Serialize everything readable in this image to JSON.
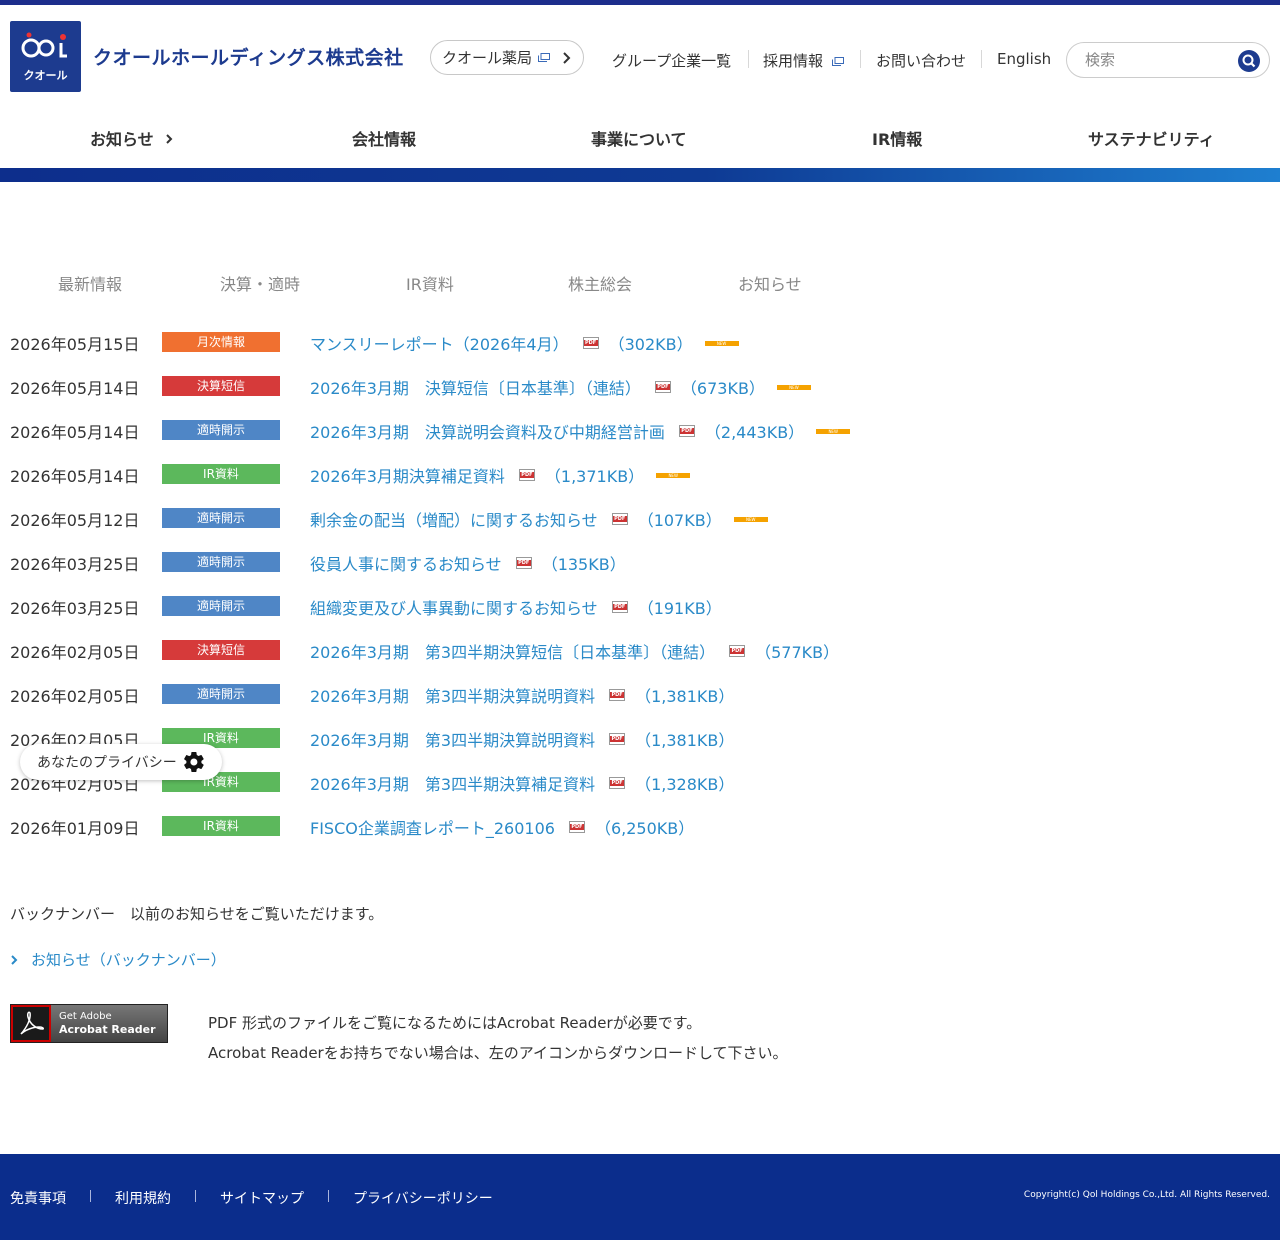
{
  "header": {
    "logo_text": "クオール",
    "company_name": "クオールホールディングス株式会社",
    "pharmacy_button": "クオール薬局",
    "links": [
      "グループ企業一覧",
      "採用情報",
      "お問い合わせ",
      "English"
    ],
    "search_placeholder": "検索"
  },
  "gnav": [
    "お知らせ",
    "会社情報",
    "事業について",
    "IR情報",
    "サステナビリティ"
  ],
  "tabs": [
    "最新情報",
    "決算・適時",
    "IR資料",
    "株主総会",
    "お知らせ"
  ],
  "news": [
    {
      "date": "2026年05月15日",
      "badge": "月次情報",
      "color": "#f07030",
      "title": "マンスリーレポート（2026年4月）",
      "size": "（302KB）",
      "new": true
    },
    {
      "date": "2026年05月14日",
      "badge": "決算短信",
      "color": "#d63a3a",
      "title": "2026年3月期　決算短信〔日本基準〕（連結）",
      "size": "（673KB）",
      "new": true
    },
    {
      "date": "2026年05月14日",
      "badge": "適時開示",
      "color": "#4f86c6",
      "title": "2026年3月期　決算説明会資料及び中期経営計画",
      "size": "（2,443KB）",
      "new": true
    },
    {
      "date": "2026年05月14日",
      "badge": "IR資料",
      "color": "#5cb85c",
      "title": "2026年3月期決算補足資料",
      "size": "（1,371KB）",
      "new": true
    },
    {
      "date": "2026年05月12日",
      "badge": "適時開示",
      "color": "#4f86c6",
      "title": "剰余金の配当（増配）に関するお知らせ",
      "size": "（107KB）",
      "new": true
    },
    {
      "date": "2026年03月25日",
      "badge": "適時開示",
      "color": "#4f86c6",
      "title": "役員人事に関するお知らせ",
      "size": "（135KB）",
      "new": false
    },
    {
      "date": "2026年03月25日",
      "badge": "適時開示",
      "color": "#4f86c6",
      "title": "組織変更及び人事異動に関するお知らせ",
      "size": "（191KB）",
      "new": false
    },
    {
      "date": "2026年02月05日",
      "badge": "決算短信",
      "color": "#d63a3a",
      "title": "2026年3月期　第3四半期決算短信〔日本基準〕（連結）",
      "size": "（577KB）",
      "new": false
    },
    {
      "date": "2026年02月05日",
      "badge": "適時開示",
      "color": "#4f86c6",
      "title": "2026年3月期　第3四半期決算説明資料",
      "size": "（1,381KB）",
      "new": false
    },
    {
      "date": "2026年02月05日",
      "badge": "IR資料",
      "color": "#5cb85c",
      "title": "2026年3月期　第3四半期決算説明資料",
      "size": "（1,381KB）",
      "new": false
    },
    {
      "date": "2026年02月05日",
      "badge": "IR資料",
      "color": "#5cb85c",
      "title": "2026年3月期　第3四半期決算補足資料",
      "size": "（1,328KB）",
      "new": false
    },
    {
      "date": "2026年01月09日",
      "badge": "IR資料",
      "color": "#5cb85c",
      "title": "FISCO企業調査レポート_260106",
      "size": "（6,250KB）",
      "new": false
    }
  ],
  "new_label": "NEW",
  "privacy_label": "あなたのプライバシー",
  "backnumber_text": "バックナンバー　以前のお知らせをご覧いただけます。",
  "backnumber_link": "お知らせ（バックナンバー）",
  "adobe": {
    "line1": "Get Adobe",
    "line2": "Acrobat Reader",
    "note1": "PDF 形式のファイルをご覧になるためにはAcrobat Readerが必要です。",
    "note2": "Acrobat Readerをお持ちでない場合は、左のアイコンからダウンロードして下さい。"
  },
  "footer": {
    "links": [
      "免責事項",
      "利用規約",
      "サイトマップ",
      "プライバシーポリシー"
    ],
    "copyright": "Copyright(c) Qol Holdings Co.,Ltd. All Rights Reserved."
  },
  "colors": {
    "brand": "#1d3b8f",
    "footer": "#0b2d8c",
    "link": "#2a8ac8"
  }
}
